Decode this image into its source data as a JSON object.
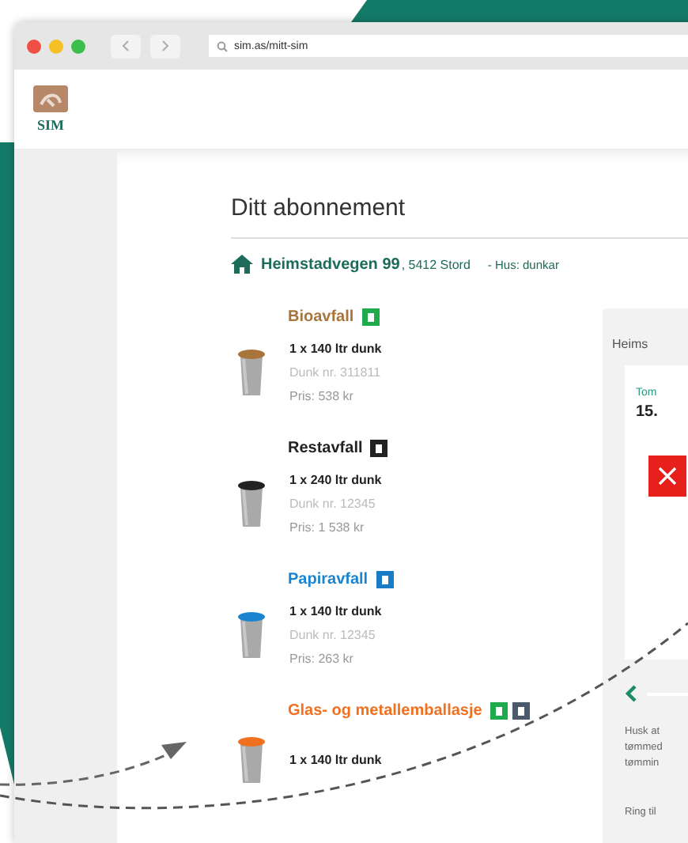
{
  "browser": {
    "url": "sim.as/mitt-sim"
  },
  "logo": {
    "text": "SIM"
  },
  "page": {
    "title": "Ditt abonnement",
    "address": {
      "street": "Heimstadvegen 99",
      "postcode": ", 5412 Stord",
      "house": "- Hus: dunkar"
    },
    "waste_items": [
      {
        "name": "Bioavfall",
        "color": "#a8743c",
        "badges": [
          {
            "color": "#1faa4b"
          }
        ],
        "size": "1 x 140 ltr dunk",
        "number": "Dunk nr. 311811",
        "price": "Pris: 538 kr"
      },
      {
        "name": "Restavfall",
        "color": "#222222",
        "badges": [
          {
            "color": "#222222"
          }
        ],
        "size": "1 x 240 ltr dunk",
        "number": "Dunk nr. 12345",
        "price": "Pris: 1 538 kr"
      },
      {
        "name": "Papiravfall",
        "color": "#1a84d0",
        "badges": [
          {
            "color": "#1a7cc4"
          }
        ],
        "size": "1 x 140 ltr dunk",
        "number": "Dunk nr. 12345",
        "price": "Pris: 263 kr"
      },
      {
        "name": "Glas- og metallemballasje",
        "color": "#f07020",
        "badges": [
          {
            "color": "#1faa4b"
          },
          {
            "color": "#4a5a6a"
          }
        ],
        "size": "1 x 140 ltr dunk"
      }
    ],
    "panel": {
      "heading": "Heims",
      "card": {
        "label": "Tom",
        "value": "15."
      },
      "notes": "Husk at\ntømmed\ntømmin",
      "call": "Ring til"
    }
  }
}
